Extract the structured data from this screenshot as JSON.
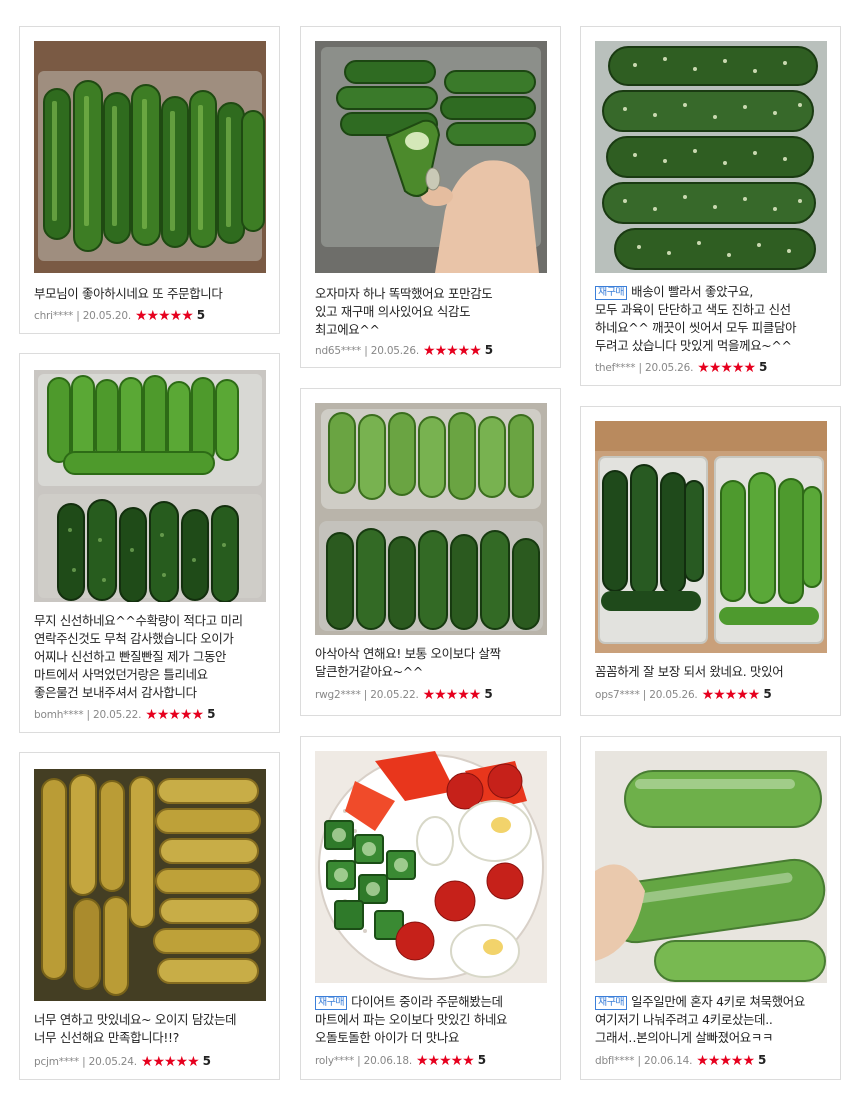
{
  "reviews": [
    {
      "text_lines": [
        "부모님이 좋아하시네요 또 주문합니다"
      ],
      "badge": "",
      "author": "chri****",
      "date": "20.05.20.",
      "stars": "★★★★★",
      "score": "5",
      "photo_icon": "cucumbers-in-clear-tray-photo"
    },
    {
      "text_lines": [
        "오자마자 하나 똑딱했어요 포만감도",
        "있고 재구매 의사있어요 식감도",
        "최고에요^^"
      ],
      "badge": "",
      "author": "nd65****",
      "date": "20.05.26.",
      "stars": "★★★★★",
      "score": "5",
      "photo_icon": "hand-holding-bitten-cucumber-photo"
    },
    {
      "text_lines": [
        "배송이 빨라서 좋았구요,",
        "모두 과육이 단단하고 색도 진하고 신선",
        "하네요^^ 깨끗이 씻어서 모두 피클담아",
        "두려고 샀습니다 맛있게 먹을께요~^^"
      ],
      "badge": "재구매",
      "author": "thef****",
      "date": "20.05.26.",
      "stars": "★★★★★",
      "score": "5",
      "photo_icon": "stacked-prickly-cucumbers-photo"
    },
    {
      "text_lines": [
        "무지 신선하네요^^수확량이 적다고 미리",
        "연락주신것도 무척 감사했습니다 오이가",
        "어찌나 신선하고 빤질빤질 제가 그동안",
        "마트에서 사먹었던거랑은 틀리네요",
        "좋은물건 보내주셔서 감사합니다"
      ],
      "badge": "",
      "author": "bomh****",
      "date": "20.05.22.",
      "stars": "★★★★★",
      "score": "5",
      "photo_icon": "two-trays-of-cucumbers-photo"
    },
    {
      "text_lines": [
        "아삭아삭 연해요! 보통 오이보다 살짝",
        "달큰한거같아요~^^"
      ],
      "badge": "",
      "author": "rwg2****",
      "date": "20.05.22.",
      "stars": "★★★★★",
      "score": "5",
      "photo_icon": "cucumber-packs-on-floor-photo"
    },
    {
      "text_lines": [
        "꼼꼼하게 잘 보장 되서 왔네요. 맛있어"
      ],
      "badge": "",
      "author": "ops7****",
      "date": "20.05.26.",
      "stars": "★★★★★",
      "score": "5",
      "photo_icon": "two-cucumber-boxes-photo"
    },
    {
      "text_lines": [
        "너무 연하고 맛있네요~ 오이지 담갔는데",
        "너무 신선해요 만족합니다!!?"
      ],
      "badge": "",
      "author": "pcjm****",
      "date": "20.05.24.",
      "stars": "★★★★★",
      "score": "5",
      "photo_icon": "pickled-cucumbers-in-brine-photo"
    },
    {
      "text_lines": [
        "다이어트 중이라 주문해봤는데",
        "마트에서 파는 오이보다 맛있긴 하네요",
        "오돌토돌한 아이가 더 맛나요"
      ],
      "badge": "재구매",
      "author": "roly****",
      "date": "20.06.18.",
      "stars": "★★★★★",
      "score": "5",
      "photo_icon": "salad-plate-photo"
    },
    {
      "text_lines": [
        "일주일만에 혼자 4키로 쳐묵했어요",
        "여기저기 나눠주려고 4키로샀는데..",
        "그래서‥본의아니게 살빠졌어요ㅋㅋ"
      ],
      "badge": "재구매",
      "author": "dbfl****",
      "date": "20.06.14.",
      "stars": "★★★★★",
      "score": "5",
      "photo_icon": "cucumbers-in-plastic-bag-photo"
    }
  ]
}
